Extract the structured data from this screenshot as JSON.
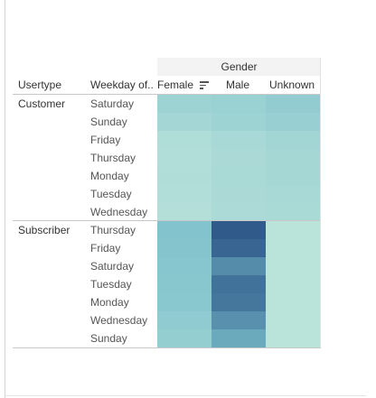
{
  "chart_data": {
    "type": "heatmap",
    "column_group_title": "Gender",
    "row_headers": [
      "Usertype",
      "Weekday of.."
    ],
    "columns": [
      "Female",
      "Male",
      "Unknown"
    ],
    "sort_column": "Female",
    "color_scale": {
      "low": "#bfe6db",
      "mid": "#7bbfcb",
      "high": "#2b5486"
    },
    "groups": [
      {
        "usertype": "Customer",
        "rows": [
          {
            "weekday": "Saturday",
            "values": [
              0.24,
              0.27,
              0.33
            ]
          },
          {
            "weekday": "Sunday",
            "values": [
              0.2,
              0.25,
              0.29
            ]
          },
          {
            "weekday": "Friday",
            "values": [
              0.12,
              0.17,
              0.21
            ]
          },
          {
            "weekday": "Thursday",
            "values": [
              0.1,
              0.15,
              0.19
            ]
          },
          {
            "weekday": "Monday",
            "values": [
              0.11,
              0.16,
              0.19
            ]
          },
          {
            "weekday": "Tuesday",
            "values": [
              0.1,
              0.15,
              0.17
            ]
          },
          {
            "weekday": "Wednesday",
            "values": [
              0.09,
              0.14,
              0.16
            ]
          }
        ]
      },
      {
        "usertype": "Subscriber",
        "rows": [
          {
            "weekday": "Thursday",
            "values": [
              0.45,
              0.97,
              0.04
            ]
          },
          {
            "weekday": "Friday",
            "values": [
              0.43,
              0.92,
              0.04
            ]
          },
          {
            "weekday": "Saturday",
            "values": [
              0.41,
              0.74,
              0.04
            ]
          },
          {
            "weekday": "Tuesday",
            "values": [
              0.4,
              0.86,
              0.04
            ]
          },
          {
            "weekday": "Monday",
            "values": [
              0.39,
              0.84,
              0.04
            ]
          },
          {
            "weekday": "Wednesday",
            "values": [
              0.35,
              0.72,
              0.04
            ]
          },
          {
            "weekday": "Sunday",
            "values": [
              0.31,
              0.6,
              0.04
            ]
          }
        ]
      }
    ]
  }
}
